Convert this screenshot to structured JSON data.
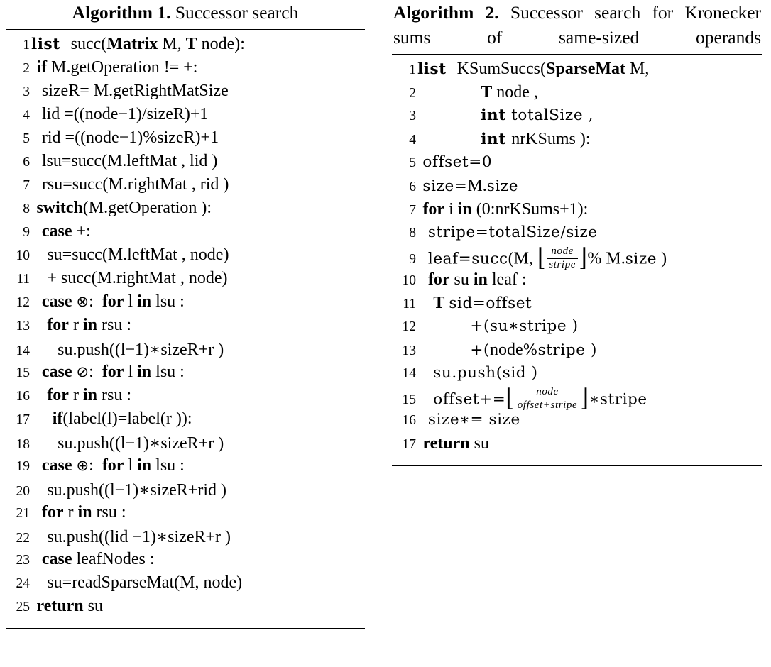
{
  "page": {
    "background": "#ffffff",
    "text_color": "#000000"
  },
  "algorithms": [
    {
      "id": "algorithm-1",
      "caption_label": "Algorithm 1.",
      "caption_title": "Successor search",
      "lines": [
        {
          "n": "1",
          "indent": 0,
          "text": "list  succ(Matrix M, T node):"
        },
        {
          "n": "2",
          "indent": 0,
          "text": "if M.getOperation != +:"
        },
        {
          "n": "3",
          "indent": 1,
          "text": "sizeR= M.getRightMatSize"
        },
        {
          "n": "4",
          "indent": 1,
          "text": "lid =((node-1)/sizeR)+1"
        },
        {
          "n": "5",
          "indent": 1,
          "text": "rid =((node-1)%sizeR)+1"
        },
        {
          "n": "6",
          "indent": 1,
          "text": "lsu=succ(M.leftMat , lid )"
        },
        {
          "n": "7",
          "indent": 1,
          "text": "rsu=succ(M.rightMat , rid )"
        },
        {
          "n": "8",
          "indent": 0,
          "text": "switch(M.getOperation ):"
        },
        {
          "n": "9",
          "indent": 1,
          "text": "case +:"
        },
        {
          "n": "10",
          "indent": 2,
          "text": "su=succ(M.leftMat , node)"
        },
        {
          "n": "11",
          "indent": 2,
          "text": "+ succ(M.rightMat , node)"
        },
        {
          "n": "12",
          "indent": 1,
          "text": "case ⊗:  for l in lsu :"
        },
        {
          "n": "13",
          "indent": 2,
          "text": "for r in rsu :"
        },
        {
          "n": "14",
          "indent": 3,
          "text": "su.push((l-1)*sizeR+r )"
        },
        {
          "n": "15",
          "indent": 1,
          "text": "case ⊘:  for l in lsu :"
        },
        {
          "n": "16",
          "indent": 2,
          "text": "for r in rsu :"
        },
        {
          "n": "17",
          "indent": 3,
          "text": "if(label(l)=label(r )):"
        },
        {
          "n": "18",
          "indent": 4,
          "text": "su.push((l-1)*sizeR+r )"
        },
        {
          "n": "19",
          "indent": 1,
          "text": "case ⊕:  for l in lsu :"
        },
        {
          "n": "20",
          "indent": 2,
          "text": "su.push((l-1)*sizeR+rid )"
        },
        {
          "n": "21",
          "indent": 1,
          "text": "for r in rsu :"
        },
        {
          "n": "22",
          "indent": 2,
          "text": "su.push((lid -1)*sizeR+r )"
        },
        {
          "n": "23",
          "indent": 1,
          "text": "case leafNodes :"
        },
        {
          "n": "24",
          "indent": 2,
          "text": "su=readSparseMat(M, node)"
        },
        {
          "n": "25",
          "indent": 0,
          "text": "return su"
        }
      ]
    },
    {
      "id": "algorithm-2",
      "caption_label": "Algorithm 2.",
      "caption_title": "Successor search for Kronecker sums of same-sized operands",
      "lines": [
        {
          "n": "1",
          "indent": 0,
          "text": "list  KSumSuccs(SparseMat M,"
        },
        {
          "n": "2",
          "indent": 0,
          "text": "T node ,"
        },
        {
          "n": "3",
          "indent": 0,
          "text": "int totalSize ,"
        },
        {
          "n": "4",
          "indent": 0,
          "text": "int nrKSums ):"
        },
        {
          "n": "5",
          "indent": 0,
          "text": "offset=0"
        },
        {
          "n": "6",
          "indent": 0,
          "text": "size=M.size"
        },
        {
          "n": "7",
          "indent": 0,
          "text": "for i in (0:nrKSums+1):"
        },
        {
          "n": "8",
          "indent": 1,
          "text": "stripe=totalSize/size"
        },
        {
          "n": "9",
          "indent": 1,
          "text": "leaf=succ(M, ⌊node/stripe⌋% M.size )"
        },
        {
          "n": "10",
          "indent": 1,
          "text": "for su in leaf :"
        },
        {
          "n": "11",
          "indent": 2,
          "text": "T sid=offset"
        },
        {
          "n": "12",
          "indent": 2,
          "text": "+(su*stripe )"
        },
        {
          "n": "13",
          "indent": 2,
          "text": "+(node%stripe )"
        },
        {
          "n": "14",
          "indent": 1,
          "text": "su.push(sid )"
        },
        {
          "n": "15",
          "indent": 1,
          "text": "offset+=⌊node/(offset+stripe)⌋*stripe"
        },
        {
          "n": "16",
          "indent": 1,
          "text": "size*= size"
        },
        {
          "n": "17",
          "indent": 0,
          "text": "return su"
        }
      ],
      "fractions": {
        "line9": {
          "numerator": "node",
          "denominator": "stripe"
        },
        "line15": {
          "numerator": "node",
          "denominator": "offset+stripe"
        }
      }
    }
  ]
}
